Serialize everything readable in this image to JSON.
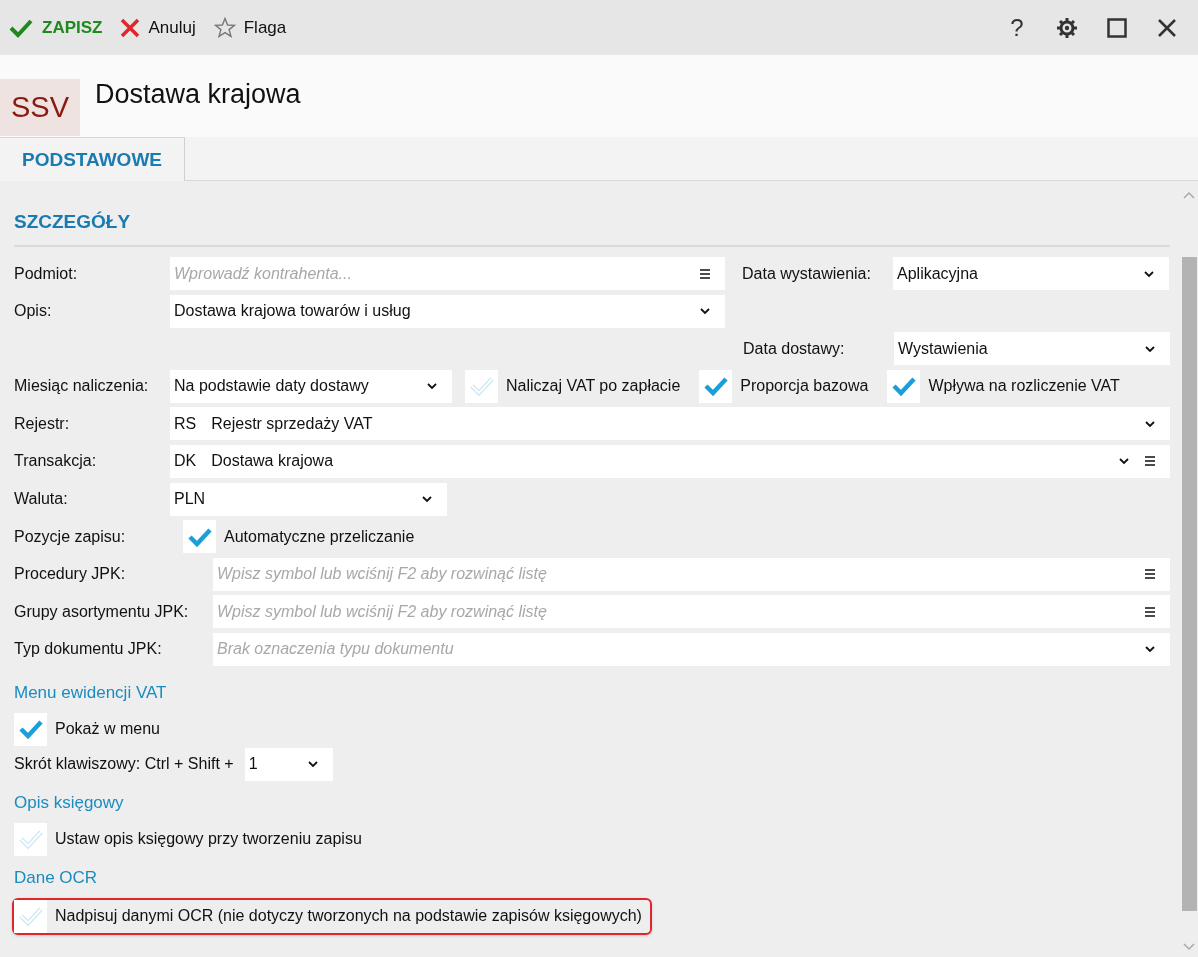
{
  "toolbar": {
    "actions": [
      {
        "kind": "save",
        "label": "ZAPISZ"
      },
      {
        "kind": "cancel",
        "label": "Anuluj"
      },
      {
        "kind": "flag",
        "label": "Flaga"
      }
    ],
    "help": "?"
  },
  "header": {
    "badge": "SSV",
    "title": "Dostawa krajowa"
  },
  "tabs": [
    {
      "label": "PODSTAWOWE",
      "selected": true
    }
  ],
  "section_title": "SZCZEGÓŁY",
  "rows": [
    [
      {
        "kind": "label",
        "text": "Podmiot:"
      },
      {
        "kind": "lookup",
        "placeholder": "Wprowadź kontrahenta..."
      },
      {
        "kind": "label",
        "text": "Data wystawienia:"
      },
      {
        "kind": "select",
        "value": "Aplikacyjna"
      }
    ],
    [
      {
        "kind": "label",
        "text": "Opis:"
      },
      {
        "kind": "select",
        "value": "Dostawa krajowa towarów i usług"
      }
    ],
    [
      {
        "kind": "label",
        "text": "Data dostawy:"
      },
      {
        "kind": "select",
        "value": "Wystawienia"
      }
    ],
    [
      {
        "kind": "label",
        "text": "Miesiąc naliczenia:"
      },
      {
        "kind": "select",
        "value": "Na podstawie daty dostawy"
      },
      {
        "kind": "checkbox",
        "label": "Naliczaj VAT po zapłacie",
        "checked": false
      },
      {
        "kind": "checkbox",
        "label": "Proporcja bazowa",
        "checked": true
      },
      {
        "kind": "checkbox",
        "label": "Wpływa na rozliczenie VAT",
        "checked": true
      }
    ],
    [
      {
        "kind": "label",
        "text": "Rejestr:"
      },
      {
        "kind": "select",
        "code": "RS",
        "value": "Rejestr sprzedaży VAT"
      }
    ],
    [
      {
        "kind": "label",
        "text": "Transakcja:"
      },
      {
        "kind": "select-lookup",
        "code": "DK",
        "value": "Dostawa krajowa"
      }
    ],
    [
      {
        "kind": "label",
        "text": "Waluta:"
      },
      {
        "kind": "select",
        "value": "PLN"
      }
    ],
    [
      {
        "kind": "label",
        "text": "Pozycje zapisu:"
      },
      {
        "kind": "checkbox",
        "label": "Automatyczne przeliczanie",
        "checked": true
      }
    ],
    [
      {
        "kind": "label",
        "text": "Procedury JPK:"
      },
      {
        "kind": "lookup",
        "placeholder": "Wpisz symbol lub wciśnij F2 aby rozwinąć listę"
      }
    ],
    [
      {
        "kind": "label",
        "text": "Grupy asortymentu JPK:"
      },
      {
        "kind": "lookup",
        "placeholder": "Wpisz symbol lub wciśnij F2 aby rozwinąć listę"
      }
    ],
    [
      {
        "kind": "label",
        "text": "Typ dokumentu JPK:"
      },
      {
        "kind": "select",
        "placeholder": "Brak oznaczenia typu dokumentu"
      }
    ]
  ],
  "groups": [
    {
      "title": "Menu ewidencji VAT",
      "checkbox": {
        "label": "Pokaż w menu",
        "checked": true
      },
      "shortcut": {
        "label": "Skrót klawiszowy: Ctrl + Shift +",
        "value": "1"
      }
    },
    {
      "title": "Opis księgowy",
      "checkbox": {
        "label": "Ustaw opis księgowy przy tworzeniu zapisu",
        "checked": false
      }
    },
    {
      "title": "Dane OCR",
      "checkbox": {
        "label": "Nadpisuj danymi OCR (nie dotyczy tworzonych na podstawie zapisów księgowych)",
        "checked": false,
        "highlighted": true
      }
    }
  ]
}
